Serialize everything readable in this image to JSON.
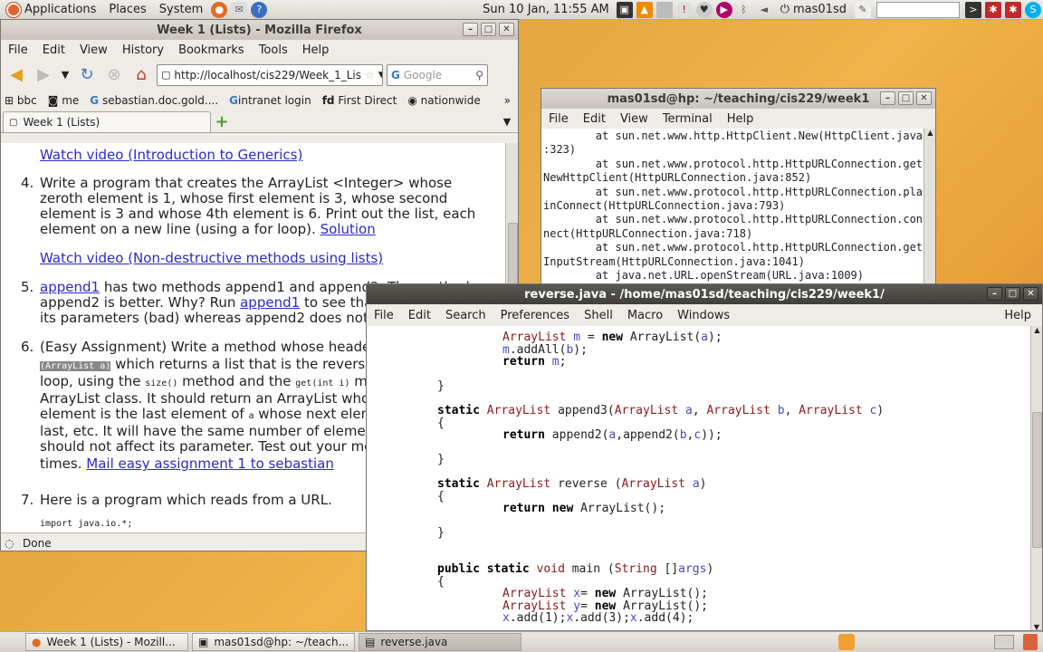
{
  "top_panel": {
    "menus": [
      "Applications",
      "Places",
      "System"
    ],
    "clock": "Sun 10 Jan, 11:55 AM",
    "user": "mas01sd"
  },
  "firefox": {
    "title": "Week 1 (Lists) - Mozilla Firefox",
    "menus": [
      "File",
      "Edit",
      "View",
      "History",
      "Bookmarks",
      "Tools",
      "Help"
    ],
    "url": "http://localhost/cis229/Week_1_Lis",
    "search_placeholder": "Google",
    "bookmarks": [
      "bbc",
      "me",
      "sebastian.doc.gold....",
      "intranet login",
      "First Direct",
      "nationwide"
    ],
    "tab_label": "Week 1 (Lists)",
    "status": "Done",
    "content": {
      "link_generics": "Watch video (Introduction to Generics)",
      "item4_num": "4.",
      "item4_text": "Write a program that creates the ArrayList <Integer> whose zeroth element is 1, whose first element is 3, whose second element is 3 and whose 4th element is 6. Print out the list, each element on a new line (using a for loop).",
      "item4_link": "Solution",
      "link_nondestructive": "Watch video (Non-destructive methods using lists)",
      "item5_num": "5.",
      "item5_link": "append1",
      "item5_text": "has two methods append1 and append2. The method append2 is better. Why? Run",
      "item5_link2": "append1",
      "item5_text2": "to see that append1 affects its parameters (bad) whereas append2 does not.",
      "item6_num": "6.",
      "item6_text_a": "(Easy Assignment) Write a method whose header is",
      "item6_code": "ArrayList reverse (ArrayList a)",
      "item6_text_b": "which returns a list that is the reverse; You will need a loop, using the",
      "item6_code2": "size()",
      "item6_text_c": "method and the",
      "item6_code3": "get(int i)",
      "item6_text_d": "method from the ArrayList class. It should return an ArrayList whose zeroth element is the last element of",
      "item6_code4": "a",
      "item6_text_e": "whose next element is the second last, etc. It will have the same number of elements as a, and should not affect its parameter. Test out your method in",
      "item6_code5": "main",
      "item6_text_f": "a few times.",
      "item6_link": "Mail easy assignment 1 to sebastian",
      "item7_num": "7.",
      "item7_text": "Here is a program which reads from a URL.",
      "code_line": "import java.io.*;"
    }
  },
  "terminal": {
    "title": "mas01sd@hp: ~/teaching/cis229/week1",
    "menus": [
      "File",
      "Edit",
      "View",
      "Terminal",
      "Help"
    ],
    "lines": [
      "        at sun.net.www.http.HttpClient.New(HttpClient.java",
      ":323)",
      "        at sun.net.www.protocol.http.HttpURLConnection.get",
      "NewHttpClient(HttpURLConnection.java:852)",
      "        at sun.net.www.protocol.http.HttpURLConnection.pla",
      "inConnect(HttpURLConnection.java:793)",
      "        at sun.net.www.protocol.http.HttpURLConnection.con",
      "nect(HttpURLConnection.java:718)",
      "        at sun.net.www.protocol.http.HttpURLConnection.get",
      "InputStream(HttpURLConnection.java:1041)",
      "        at java.net.URL.openStream(URL.java:1009)"
    ]
  },
  "editor": {
    "title": "reverse.java - /home/mas01sd/teaching/cis229/week1/",
    "menus": [
      "File",
      "Edit",
      "Search",
      "Preferences",
      "Shell",
      "Macro",
      "Windows"
    ],
    "help": "Help"
  },
  "taskbar": {
    "items": [
      "Week 1 (Lists) - Mozill...",
      "mas01sd@hp: ~/teach...",
      "reverse.java"
    ]
  }
}
